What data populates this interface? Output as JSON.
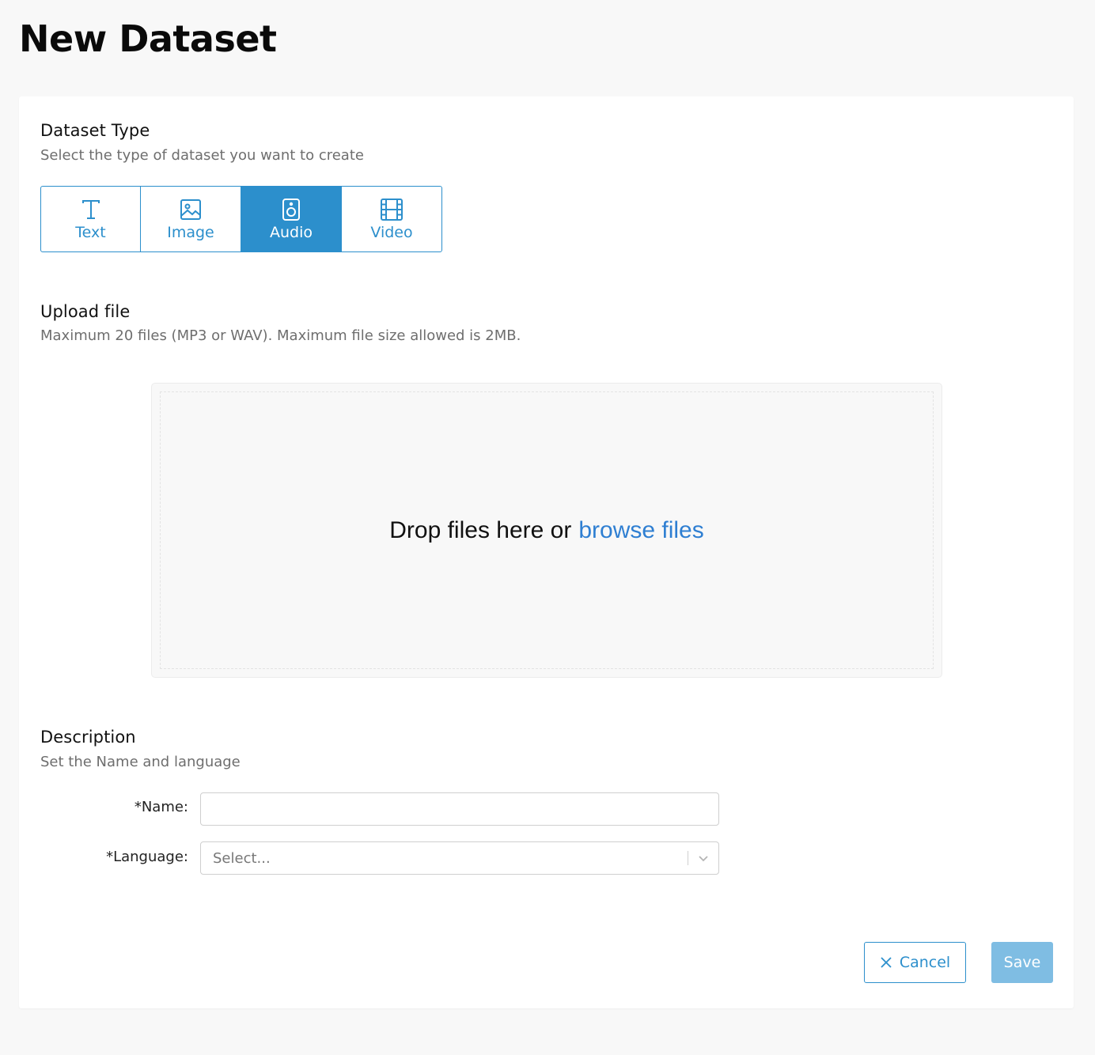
{
  "page": {
    "title": "New Dataset"
  },
  "dataset_type": {
    "title": "Dataset Type",
    "subtitle": "Select the type of dataset you want to create",
    "selected": "Audio",
    "options": [
      {
        "label": "Text",
        "icon": "text-icon"
      },
      {
        "label": "Image",
        "icon": "image-icon"
      },
      {
        "label": "Audio",
        "icon": "speaker-icon"
      },
      {
        "label": "Video",
        "icon": "film-icon"
      }
    ]
  },
  "upload": {
    "title": "Upload file",
    "subtitle": "Maximum 20 files (MP3 or WAV). Maximum file size allowed is 2MB.",
    "drop_text": "Drop files here or",
    "browse_link": "browse files"
  },
  "description": {
    "title": "Description",
    "subtitle": "Set the Name and language",
    "name_label": "*Name:",
    "name_value": "",
    "language_label": "*Language:",
    "language_placeholder": "Select..."
  },
  "actions": {
    "cancel_label": "Cancel",
    "save_label": "Save"
  },
  "colors": {
    "accent": "#2c8fcc",
    "save_disabled": "#7fbde3",
    "link": "#2f7fd2"
  }
}
